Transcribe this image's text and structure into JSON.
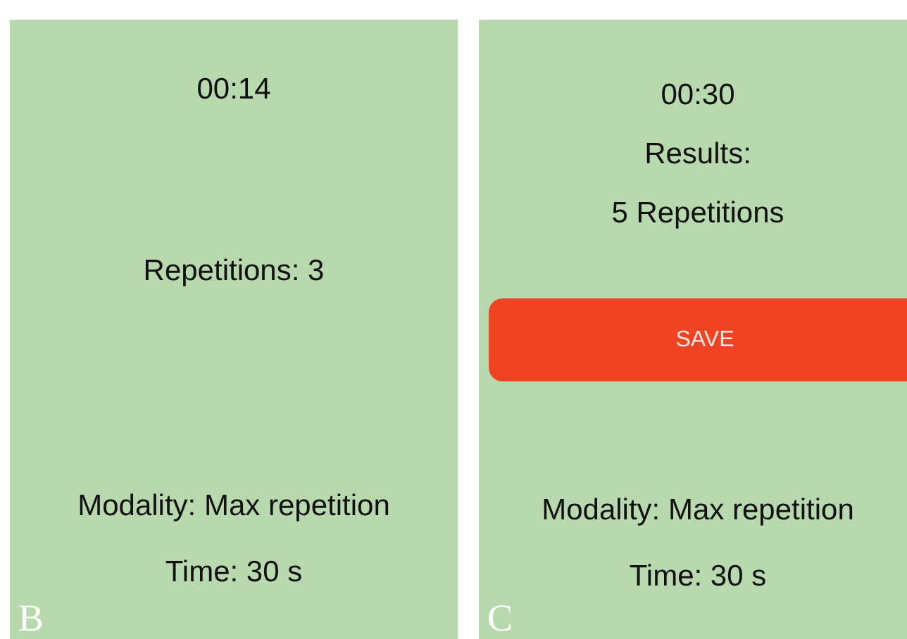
{
  "panels": [
    {
      "label": "B",
      "timer": "00:14",
      "lines": [
        "Repetitions: 3"
      ],
      "modality": "Modality: Max repetition",
      "time": "Time: 30 s"
    },
    {
      "label": "C",
      "timer": "00:30",
      "lines": [
        "Results:",
        "5 Repetitions"
      ],
      "save_button": "SAVE",
      "modality": "Modality: Max repetition",
      "time": "Time: 30 s"
    }
  ]
}
